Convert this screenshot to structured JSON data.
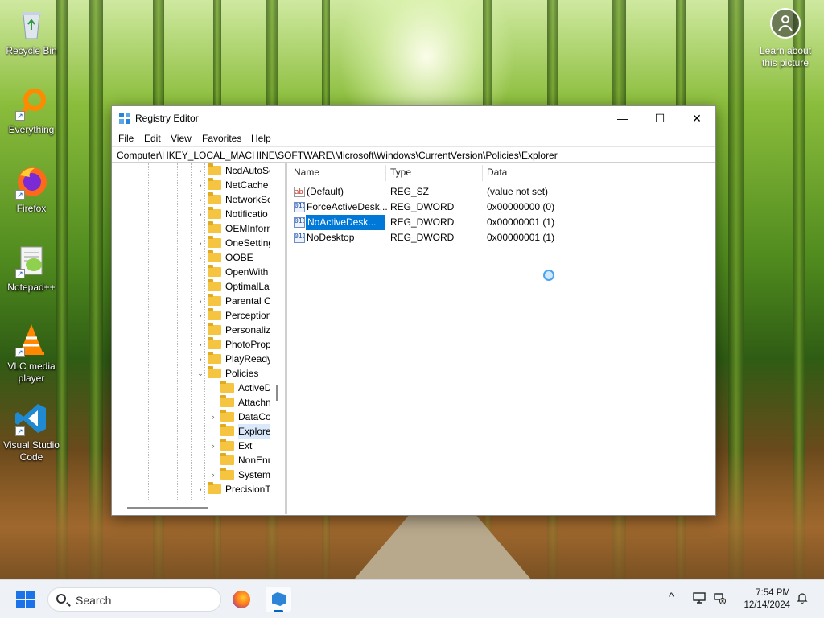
{
  "desktop": {
    "icons": [
      {
        "label": "Recycle Bin",
        "icon": "recycle-bin-icon"
      },
      {
        "label": "Everything",
        "icon": "everything-search-icon"
      },
      {
        "label": "Firefox",
        "icon": "firefox-icon"
      },
      {
        "label": "Notepad++",
        "icon": "notepad-plus-plus-icon"
      },
      {
        "label": "VLC media player",
        "icon": "vlc-icon"
      },
      {
        "label": "Visual Studio Code",
        "icon": "vscode-icon"
      }
    ],
    "learn_about": "Learn about this picture"
  },
  "window": {
    "title": "Registry Editor",
    "menu": [
      "File",
      "Edit",
      "View",
      "Favorites",
      "Help"
    ],
    "address": "Computer\\HKEY_LOCAL_MACHINE\\SOFTWARE\\Microsoft\\Windows\\CurrentVersion\\Policies\\Explorer",
    "controls": {
      "minimize": "—",
      "maximize": "☐",
      "close": "✕"
    }
  },
  "tree": {
    "nodes": [
      {
        "label": "NcdAutoSe",
        "depth": 0,
        "expander": "›"
      },
      {
        "label": "NetCache",
        "depth": 0,
        "expander": "›"
      },
      {
        "label": "NetworkSe",
        "depth": 0,
        "expander": "›"
      },
      {
        "label": "Notificatio",
        "depth": 0,
        "expander": "›"
      },
      {
        "label": "OEMInforn",
        "depth": 0,
        "expander": ""
      },
      {
        "label": "OneSetting",
        "depth": 0,
        "expander": "›"
      },
      {
        "label": "OOBE",
        "depth": 0,
        "expander": "›"
      },
      {
        "label": "OpenWith",
        "depth": 0,
        "expander": ""
      },
      {
        "label": "OptimalLay",
        "depth": 0,
        "expander": ""
      },
      {
        "label": "Parental Co",
        "depth": 0,
        "expander": "›"
      },
      {
        "label": "Perception",
        "depth": 0,
        "expander": "›"
      },
      {
        "label": "Personaliza",
        "depth": 0,
        "expander": ""
      },
      {
        "label": "PhotoProp",
        "depth": 0,
        "expander": "›"
      },
      {
        "label": "PlayReady",
        "depth": 0,
        "expander": "›"
      },
      {
        "label": "Policies",
        "depth": 0,
        "expander": "⌄"
      },
      {
        "label": "ActiveD",
        "depth": 1,
        "expander": ""
      },
      {
        "label": "Attachn",
        "depth": 1,
        "expander": ""
      },
      {
        "label": "DataCol",
        "depth": 1,
        "expander": "›"
      },
      {
        "label": "Explorer",
        "depth": 1,
        "expander": "",
        "selected": true
      },
      {
        "label": "Ext",
        "depth": 1,
        "expander": "›"
      },
      {
        "label": "NonEnu",
        "depth": 1,
        "expander": ""
      },
      {
        "label": "System",
        "depth": 1,
        "expander": "›"
      },
      {
        "label": "PrecisionTo",
        "depth": 0,
        "expander": "›"
      }
    ]
  },
  "values_pane": {
    "columns": [
      "Name",
      "Type",
      "Data"
    ],
    "rows": [
      {
        "icon": "ab",
        "name": "(Default)",
        "type": "REG_SZ",
        "data": "(value not set)"
      },
      {
        "icon": "011",
        "name": "ForceActiveDesk...",
        "type": "REG_DWORD",
        "data": "0x00000000 (0)"
      },
      {
        "icon": "011",
        "name": "NoActiveDesk...",
        "type": "REG_DWORD",
        "data": "0x00000001 (1)",
        "selected": true
      },
      {
        "icon": "011",
        "name": "NoDesktop",
        "type": "REG_DWORD",
        "data": "0x00000001 (1)"
      }
    ]
  },
  "taskbar": {
    "search_label": "Search",
    "pinned": [
      "firefox-icon",
      "registry-editor-icon"
    ],
    "tray": {
      "chevron": "^"
    },
    "time": "7:54 PM",
    "date": "12/14/2024"
  }
}
